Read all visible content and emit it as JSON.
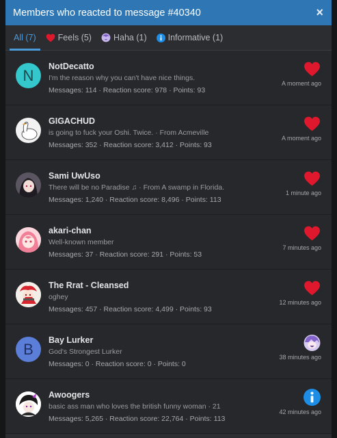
{
  "dialog": {
    "title": "Members who reacted to message #40340",
    "close_symbol": "×"
  },
  "tabs": [
    {
      "label": "All (7)",
      "icon": "none",
      "active": true
    },
    {
      "label": "Feels (5)",
      "icon": "heart-icon",
      "active": false
    },
    {
      "label": "Haha (1)",
      "icon": "haha-icon",
      "active": false
    },
    {
      "label": "Informative (1)",
      "icon": "info-icon",
      "active": false
    }
  ],
  "members": [
    {
      "username": "NotDecatto",
      "tagline": "I'm the reason why you can't have nice things.",
      "stats": "Messages: 114 · Reaction score: 978 · Points: 93",
      "reaction": "heart-icon",
      "time": "A moment ago",
      "avatar_letter": "N",
      "avatar_color": "#34c7cc"
    },
    {
      "username": "GIGACHUD",
      "tagline": "is going to fuck your Oshi. Twice. · From Acmeville",
      "stats": "Messages: 352 · Reaction score: 3,412 · Points: 93",
      "reaction": "heart-icon",
      "time": "A moment ago",
      "avatar_letter": "",
      "avatar_color": "#f2f2f2"
    },
    {
      "username": "Sami UwUso",
      "tagline": "There will be no Paradise ♫ · From A swamp in Florida.",
      "stats": "Messages: 1,240 · Reaction score: 8,496 · Points: 113",
      "reaction": "heart-icon",
      "time": "1 minute ago",
      "avatar_letter": "",
      "avatar_color": "#4a4650"
    },
    {
      "username": "akari-chan",
      "tagline": "Well-known member",
      "stats": "Messages: 37 · Reaction score: 291 · Points: 53",
      "reaction": "heart-icon",
      "time": "7 minutes ago",
      "avatar_letter": "",
      "avatar_color": "#f7b7c3"
    },
    {
      "username": "The Rrat - Cleansed",
      "tagline": "oghey",
      "stats": "Messages: 457 · Reaction score: 4,499 · Points: 93",
      "reaction": "heart-icon",
      "time": "12 minutes ago",
      "avatar_letter": "",
      "avatar_color": "#f4eee8"
    },
    {
      "username": "Bay Lurker",
      "tagline": "God's Strongest Lurker",
      "stats": "Messages: 0 · Reaction score: 0 · Points: 0",
      "reaction": "haha-icon",
      "time": "38 minutes ago",
      "avatar_letter": "B",
      "avatar_color": "#5b7fd9"
    },
    {
      "username": "Awoogers",
      "tagline": "basic ass man who loves the british funny woman · 21",
      "stats": "Messages: 5,265 · Reaction score: 22,764 · Points: 113",
      "reaction": "info-icon",
      "time": "42 minutes ago",
      "avatar_letter": "",
      "avatar_color": "#ffffff"
    }
  ],
  "colors": {
    "accent": "#2f77b4",
    "active_tab": "#4b9bdb",
    "heart": "#e0182d",
    "info": "#1d8de6"
  }
}
